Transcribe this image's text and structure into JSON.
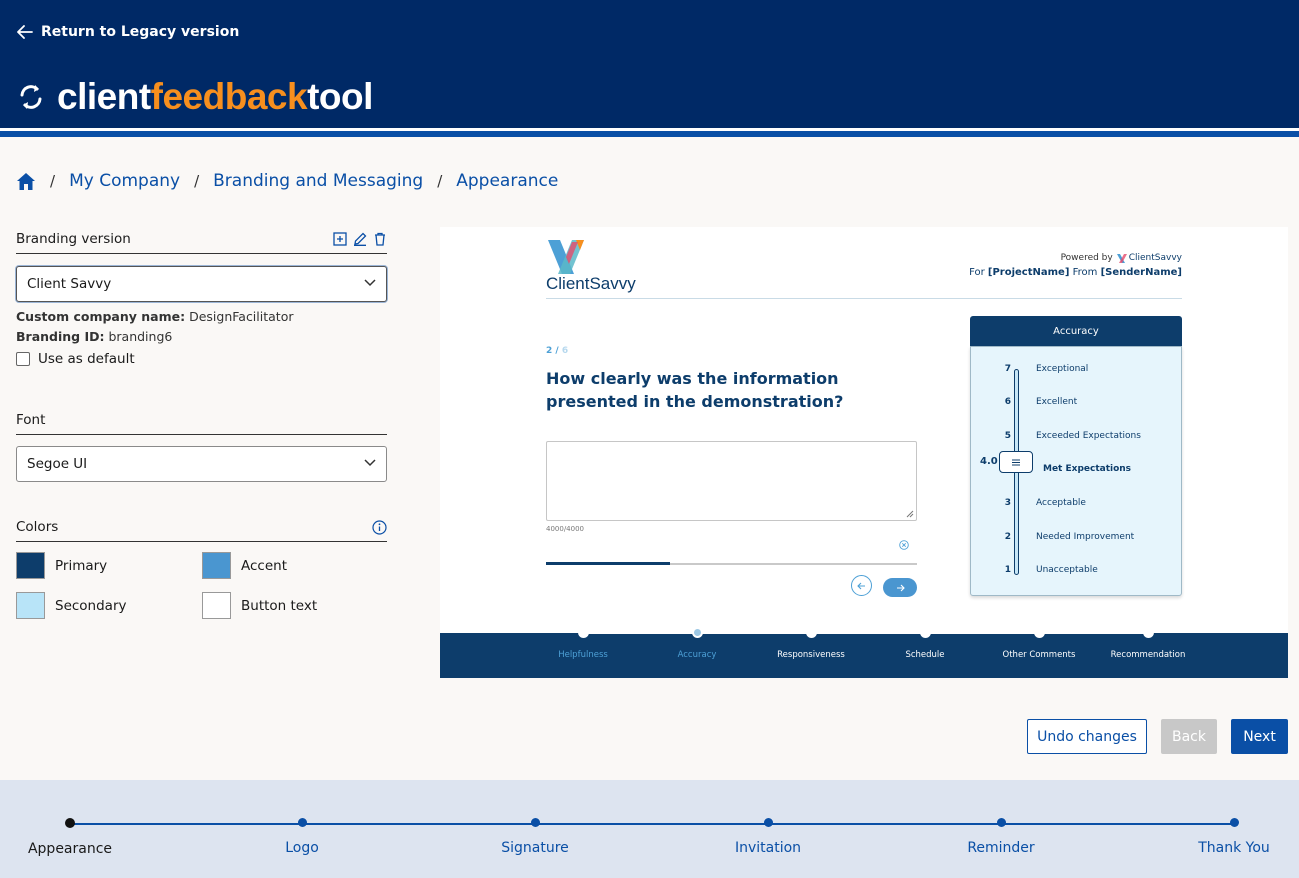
{
  "header": {
    "back_label": "Return to Legacy version",
    "brand_part1": "client",
    "brand_part2": "feedback",
    "brand_part3": "tool"
  },
  "breadcrumb": {
    "items": [
      "My Company",
      "Branding and Messaging",
      "Appearance"
    ]
  },
  "branding": {
    "title": "Branding version",
    "selected": "Client Savvy",
    "company_label": "Custom company name:",
    "company_value": "DesignFacilitator",
    "id_label": "Branding ID:",
    "id_value": "branding6",
    "default_label": "Use as default"
  },
  "font": {
    "title": "Font",
    "selected": "Segoe UI"
  },
  "colors": {
    "title": "Colors",
    "items": [
      {
        "label": "Primary",
        "color": "#0d3d6b"
      },
      {
        "label": "Accent",
        "color": "#4a96d0"
      },
      {
        "label": "Secondary",
        "color": "#b8e4f8"
      },
      {
        "label": "Button text",
        "color": "#ffffff"
      }
    ]
  },
  "preview": {
    "logo_text": "ClientSavvy",
    "powered_by": "Powered by",
    "powered_brand": "ClientSavvy",
    "for_label": "For",
    "project": "[ProjectName]",
    "from_label": "From",
    "sender": "[SenderName]",
    "counter_current": "2 /",
    "counter_total": "6",
    "question": "How clearly was the information presented in the demonstration?",
    "char_count": "4000/4000",
    "progress_fraction": 0.333,
    "scale_title": "Accuracy",
    "scale_value": "4.0",
    "scale": [
      {
        "num": "7",
        "label": "Exceptional"
      },
      {
        "num": "6",
        "label": "Excellent"
      },
      {
        "num": "5",
        "label": "Exceeded Expectations"
      },
      {
        "num": "",
        "label": "Met Expectations"
      },
      {
        "num": "3",
        "label": "Acceptable"
      },
      {
        "num": "2",
        "label": "Needed Improvement"
      },
      {
        "num": "1",
        "label": "Unacceptable"
      }
    ],
    "steps": [
      "Helpfulness",
      "Accuracy",
      "Responsiveness",
      "Schedule",
      "Other Comments",
      "Recommendation"
    ]
  },
  "actions": {
    "undo": "Undo changes",
    "back": "Back",
    "next": "Next"
  },
  "stepper": {
    "steps": [
      "Appearance",
      "Logo",
      "Signature",
      "Invitation",
      "Reminder",
      "Thank You"
    ]
  }
}
